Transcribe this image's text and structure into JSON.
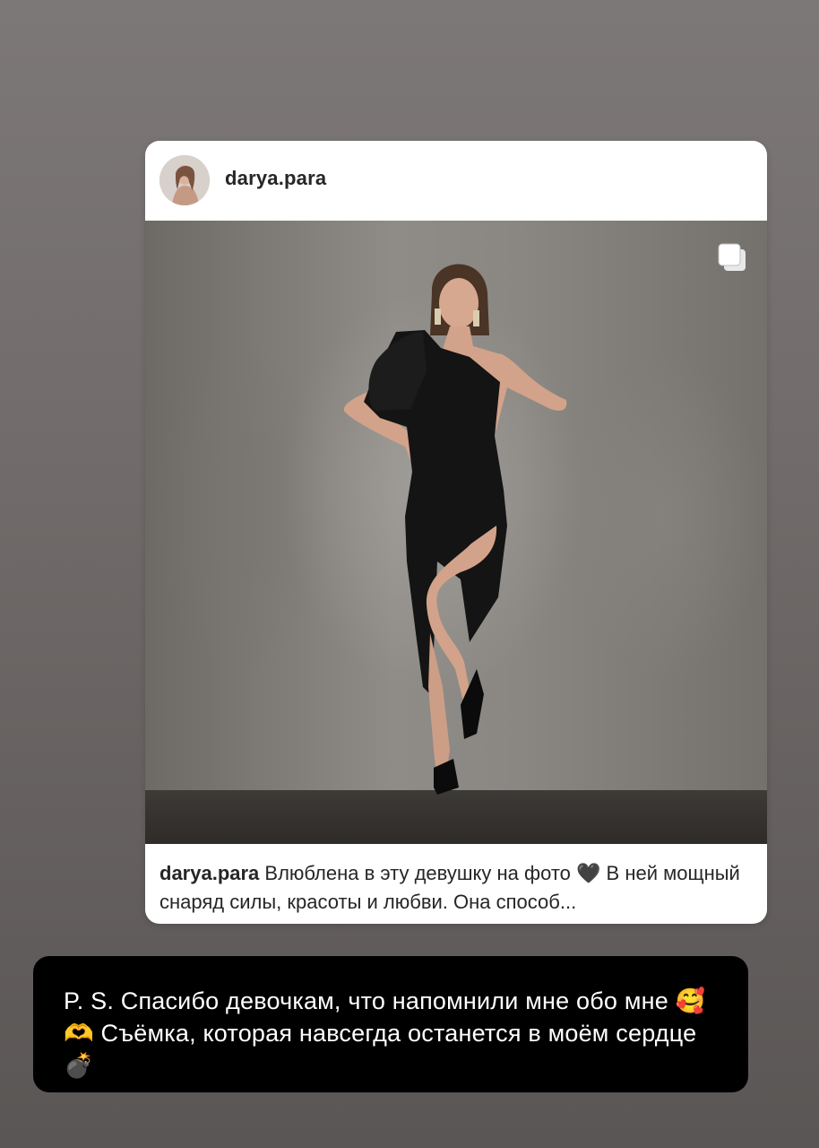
{
  "post": {
    "username": "darya.para",
    "caption_username": "darya.para",
    "caption_text": "Влюблена в эту девушку на фото 🖤 В ней мощный снаряд силы, красоты и любви. Она способ..."
  },
  "note": {
    "text": "P. S. Спасибо девочкам, что напомнили мне обо мне 🥰🫶 Съёмка, которая навсегда останется в моём сердце 💣"
  },
  "icons": {
    "avatar": "profile-avatar",
    "multi": "carousel-multiple-icon"
  },
  "colors": {
    "card_bg": "#ffffff",
    "note_bg": "#000000",
    "text_dark": "#262626"
  }
}
